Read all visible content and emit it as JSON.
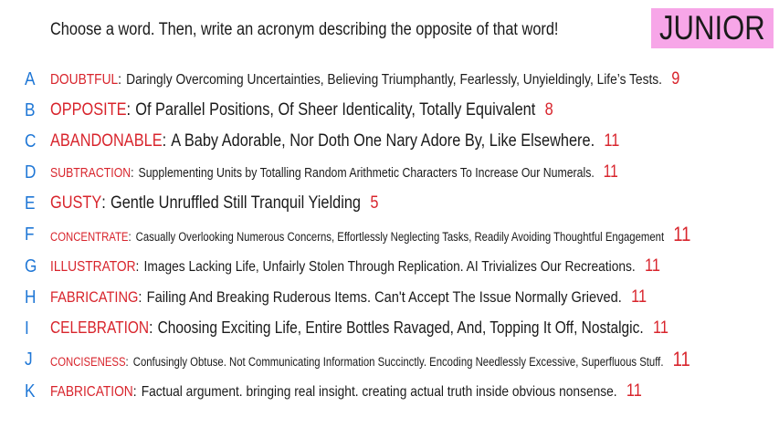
{
  "prompt": "Choose a word. Then, write an acronym describing the opposite of that word!",
  "badge": "JUNIOR",
  "rows": [
    {
      "letter": "A",
      "word": "DOUBTFUL",
      "acronym": "Daringly Overcoming Uncertainties, Believing Triumphantly, Fearlessly, Unyieldingly, Life’s Tests.",
      "count": "9"
    },
    {
      "letter": "B",
      "word": "OPPOSITE",
      "acronym": "Of Parallel Positions, Of Sheer Identicality, Totally Equivalent",
      "count": "8"
    },
    {
      "letter": "C",
      "word": "ABANDONABLE",
      "acronym": "A Baby Adorable, Nor Doth One Nary Adore By, Like Elsewhere.",
      "count": "11"
    },
    {
      "letter": "D",
      "word": "SUBTRACTION",
      "acronym": "Supplementing Units by Totalling Random Arithmetic Characters To Increase Our Numerals.",
      "count": "11"
    },
    {
      "letter": "E",
      "word": "GUSTY",
      "acronym": "Gentle Unruffled Still Tranquil Yielding",
      "count": "5"
    },
    {
      "letter": "F",
      "word": "CONCENTRATE",
      "acronym": "Casually Overlooking Numerous Concerns, Effortlessly Neglecting Tasks, Readily Avoiding Thoughtful Engagement",
      "count": "11"
    },
    {
      "letter": "G",
      "word": "ILLUSTRATOR",
      "acronym": "Images Lacking Life, Unfairly Stolen Through Replication. AI Trivializes Our Recreations.",
      "count": "11"
    },
    {
      "letter": "H",
      "word": "FABRICATING",
      "acronym": "Failing And Breaking Ruderous Items. Can't Accept The Issue Normally Grieved.",
      "count": "11"
    },
    {
      "letter": "I",
      "word": "CELEBRATION",
      "acronym": "Choosing Exciting Life, Entire Bottles Ravaged, And, Topping It Off, Nostalgic.",
      "count": "11"
    },
    {
      "letter": "J",
      "word": "CONCISENESS",
      "acronym": "Confusingly Obtuse. Not Communicating Information Succinctly. Encoding Needlessly Excessive, Superfluous Stuff.",
      "count": "11"
    },
    {
      "letter": "K",
      "word": "FABRICATION",
      "acronym": "Factual argument. bringing real insight. creating actual truth inside obvious nonsense.",
      "count": "11"
    }
  ],
  "colors": {
    "letter": "#1f77d6",
    "word": "#d8242c",
    "badge_bg": "#f7a6e8",
    "text": "#1a1a1a"
  }
}
